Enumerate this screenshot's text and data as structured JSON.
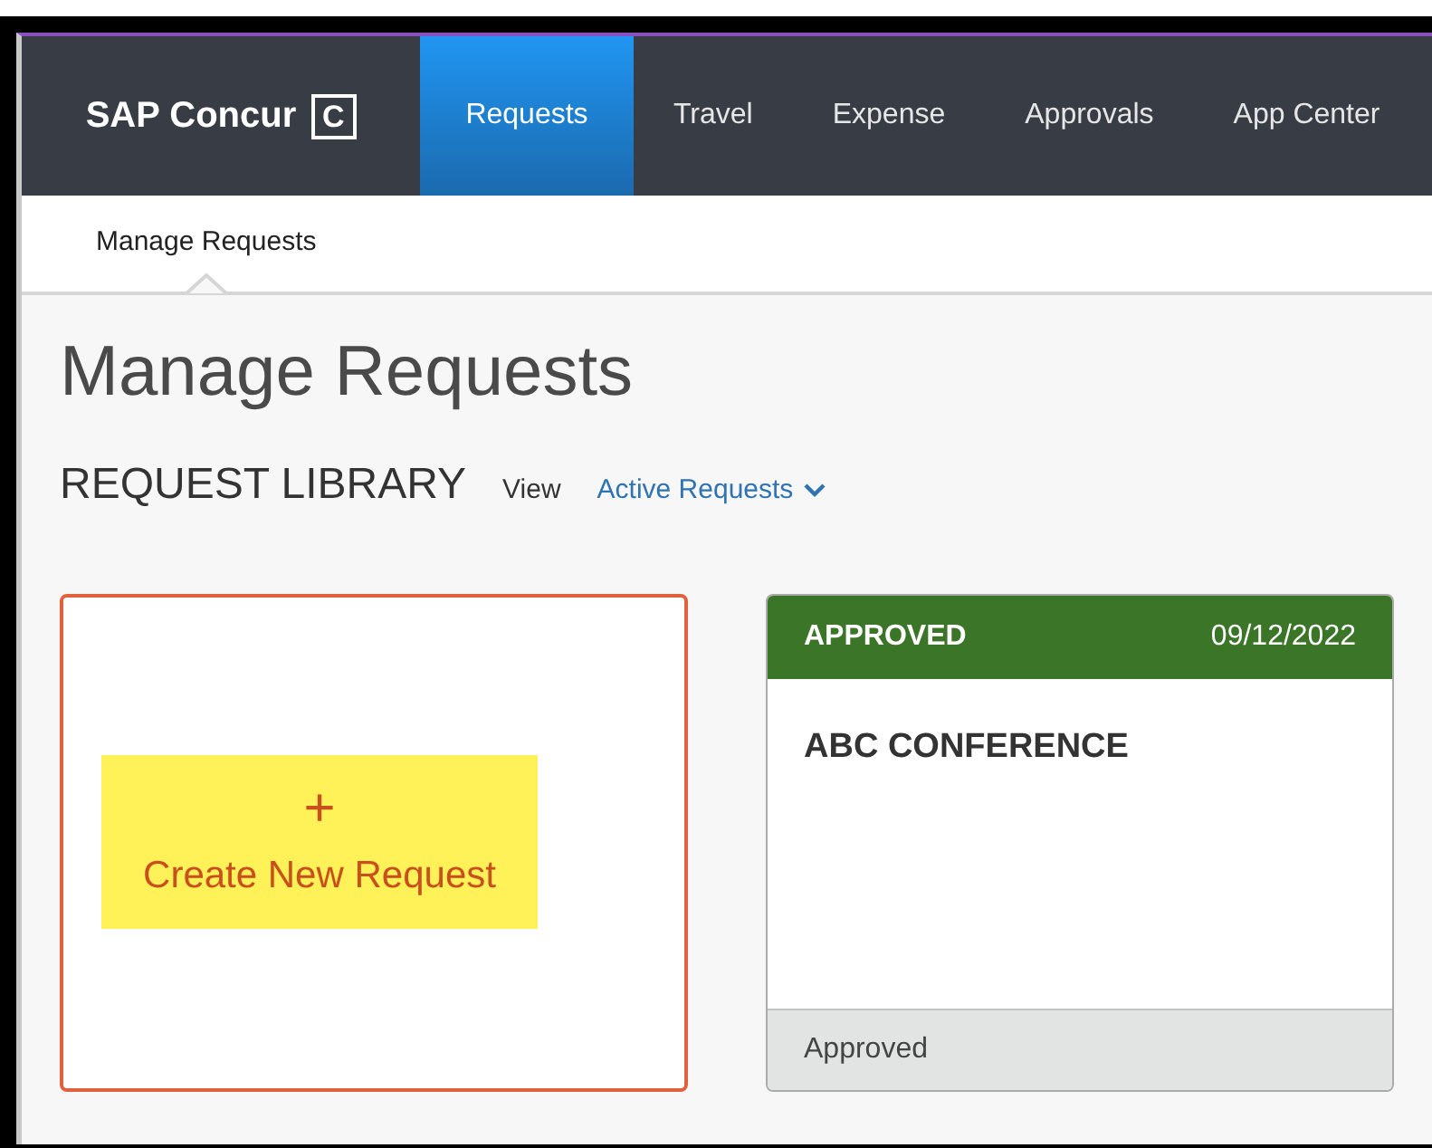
{
  "brand": {
    "name": "SAP Concur",
    "logo_glyph": "C"
  },
  "nav": [
    {
      "label": "Requests",
      "selected": true
    },
    {
      "label": "Travel",
      "selected": false
    },
    {
      "label": "Expense",
      "selected": false
    },
    {
      "label": "Approvals",
      "selected": false
    },
    {
      "label": "App Center",
      "selected": false
    }
  ],
  "subnav": [
    {
      "label": "Manage Requests",
      "selected": true
    }
  ],
  "page_title": "Manage Requests",
  "library": {
    "heading": "REQUEST LIBRARY",
    "view_label": "View",
    "view_value": "Active Requests"
  },
  "create_card": {
    "icon": "+",
    "label": "Create New Request",
    "highlighted": true
  },
  "requests": [
    {
      "status": "APPROVED",
      "date": "09/12/2022",
      "title": "ABC CONFERENCE",
      "footer": "Approved",
      "color": "#3a7528"
    }
  ]
}
